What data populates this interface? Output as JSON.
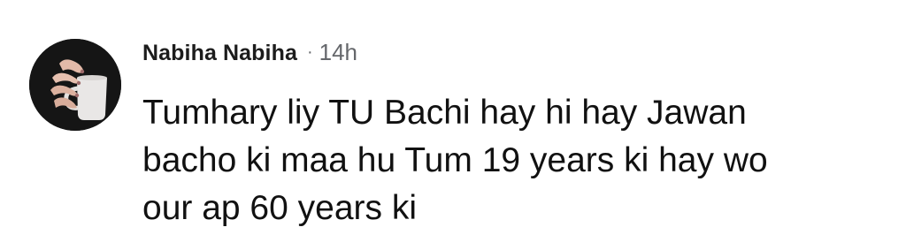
{
  "comment": {
    "author": "Nabiha Nabiha",
    "separator": "·",
    "timestamp": "14h",
    "text": "Tumhary liy TU Bachi hay hi hay Jawan bacho ki maa hu Tum 19 years ki hay wo our ap 60 years ki",
    "avatar_icon": "profile-photo-hand-holding-mug"
  }
}
